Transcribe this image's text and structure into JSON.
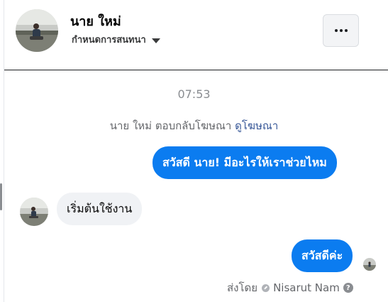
{
  "header": {
    "name": "นาย ใหม่",
    "subtitle": "กำหนดการสนทนา"
  },
  "conversation": {
    "timestamp": "07:53",
    "ad_reply_text": "นาย ใหม่ ตอบกลับโฆษณา",
    "ad_link": "ดูโฆษณา",
    "messages": [
      {
        "direction": "outgoing",
        "text": "สวัสดี นาย! มีอะไรให้เราช่วยไหม"
      },
      {
        "direction": "incoming",
        "text": "เริ่มต้นใช้งาน"
      },
      {
        "direction": "outgoing",
        "text": "สวัสดีค่ะ"
      }
    ],
    "sent_by_label": "ส่งโดย",
    "sender_name": "Nisarut Nam"
  },
  "icons": {
    "more": "more-horizontal-icon",
    "dropdown": "caret-down-icon",
    "verified": "check-circle-icon",
    "help": "help-icon"
  },
  "colors": {
    "outgoing_bubble": "#0b7cf0",
    "incoming_bubble": "#f0f2f5",
    "link": "#385898"
  }
}
